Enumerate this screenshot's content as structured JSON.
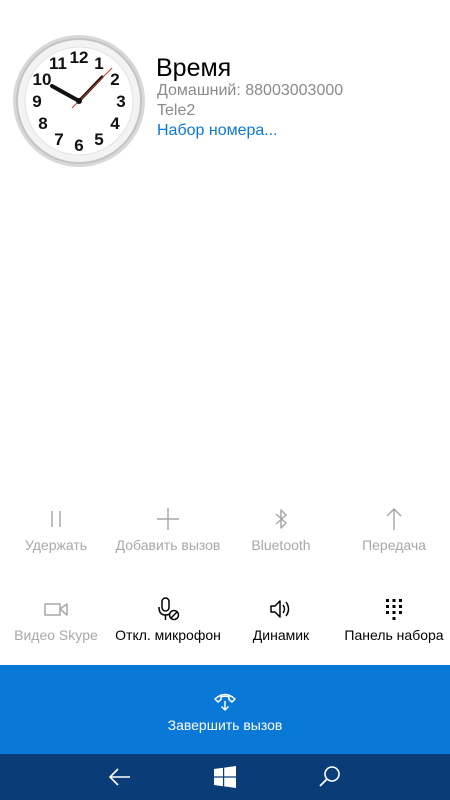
{
  "contact": {
    "name": "Время",
    "number": "Домашний: 88003003000",
    "carrier": "Tele2",
    "status": "Набор номера..."
  },
  "controls": {
    "hold": {
      "label": "Удержать",
      "icon": "pause-icon",
      "enabled": false
    },
    "add_call": {
      "label": "Добавить вызов",
      "icon": "plus-icon",
      "enabled": false
    },
    "bluetooth": {
      "label": "Bluetooth",
      "icon": "bluetooth-icon",
      "enabled": false
    },
    "transfer": {
      "label": "Передача",
      "icon": "arrow-up-icon",
      "enabled": false
    },
    "skype_video": {
      "label": "Видео Skype",
      "icon": "video-camera-icon",
      "enabled": false
    },
    "mute": {
      "label": "Откл. микрофон",
      "icon": "microphone-mute-icon",
      "enabled": true
    },
    "speaker": {
      "label": "Динамик",
      "icon": "speaker-icon",
      "enabled": true
    },
    "keypad": {
      "label": "Панель набора",
      "icon": "keypad-icon",
      "enabled": true
    }
  },
  "end_call": {
    "label": "Завершить вызов",
    "icon": "hang-up-icon"
  },
  "navbar": {
    "back_icon": "back-arrow-icon",
    "home_icon": "windows-logo-icon",
    "search_icon": "search-icon"
  },
  "colors": {
    "accent": "#0a78d7",
    "navbar": "#0a3d78",
    "disabled_text": "#a8a8a8",
    "secondary_text": "#8a8a8a"
  }
}
